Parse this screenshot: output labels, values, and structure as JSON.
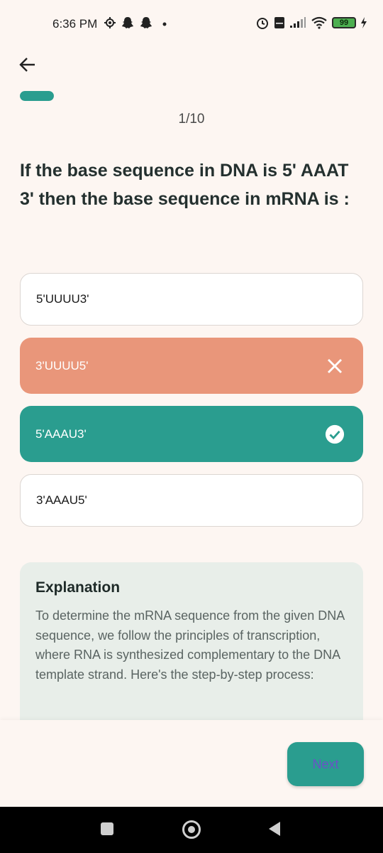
{
  "status_bar": {
    "time": "6:36 PM",
    "battery": "99",
    "icons_left": [
      "settings-icon",
      "snapchat-icon",
      "snapchat-icon",
      "dot-icon"
    ],
    "icons_right": [
      "alarm-icon",
      "volte-icon",
      "signal-icon",
      "wifi-icon",
      "battery-icon",
      "charging-icon"
    ]
  },
  "header": {
    "back_icon": "arrow-left-icon"
  },
  "progress": {
    "fraction": 0.1,
    "counter": "1/10"
  },
  "question": {
    "text": "If the base sequence in DNA is 5' AAAT 3' then the base sequence in mRNA is :"
  },
  "options": [
    {
      "label": "5'UUUU3'",
      "state": "neutral"
    },
    {
      "label": "3'UUUU5'",
      "state": "wrong",
      "icon": "close-icon"
    },
    {
      "label": "5'AAAU3'",
      "state": "correct",
      "icon": "check-circle-icon"
    },
    {
      "label": "3'AAAU5'",
      "state": "neutral"
    }
  ],
  "explanation": {
    "title": "Explanation",
    "body": "To determine the mRNA sequence from the given DNA sequence, we follow the principles of transcription, where RNA is synthesized complementary to the DNA template strand. Here's the step-by-step process:"
  },
  "footer": {
    "next_label": "Next"
  },
  "colors": {
    "accent": "#2a9d8f",
    "wrong": "#e9967a",
    "background": "#fdf6f2",
    "explanation_bg": "#e8eee9"
  }
}
